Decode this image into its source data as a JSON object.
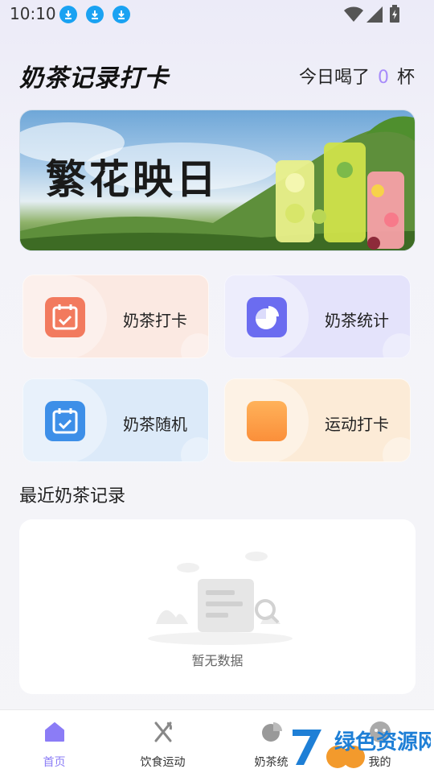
{
  "status_bar": {
    "time": "10:10"
  },
  "header": {
    "title": "奶茶记录打卡",
    "today_prefix": "今日喝了",
    "today_count": "0",
    "today_unit": "杯"
  },
  "banner": {
    "text": "繁花映日"
  },
  "cards": [
    {
      "label": "奶茶打卡",
      "icon": "calendar-check-icon",
      "color": "#f27a5e"
    },
    {
      "label": "奶茶统计",
      "icon": "pie-chart-icon",
      "color": "#6b6cf0"
    },
    {
      "label": "奶茶随机",
      "icon": "calendar-check-icon",
      "color": "#3d8fe8"
    },
    {
      "label": "运动打卡",
      "icon": "orange-square-icon",
      "color": "#fb9a3c"
    }
  ],
  "recent": {
    "title": "最近奶茶记录",
    "empty_text": "暂无数据"
  },
  "nav": [
    {
      "label": "首页",
      "icon": "home-icon",
      "active": true
    },
    {
      "label": "饮食运动",
      "icon": "utensils-icon"
    },
    {
      "label": "奶茶统",
      "icon": "pie-chart-icon"
    },
    {
      "label": "我的",
      "icon": "face-icon"
    }
  ],
  "watermark": {
    "text": "绿色资源网"
  },
  "colors": {
    "accent": "#8b7cf6",
    "count": "#a78bfa"
  }
}
